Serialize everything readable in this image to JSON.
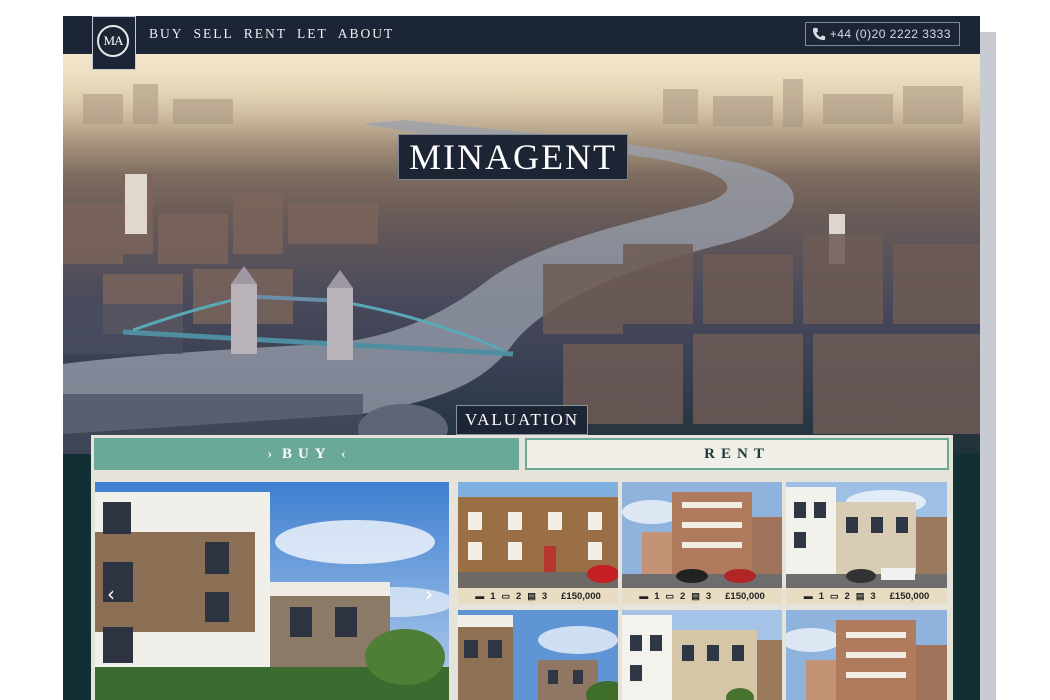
{
  "nav": {
    "logo_text": "MA",
    "menu": [
      "BUY",
      "SELL",
      "RENT",
      "LET",
      "ABOUT"
    ],
    "phone": "+44 (0)20 2222 3333",
    "phone_icon": "phone-icon"
  },
  "hero": {
    "title": "MINAGENT",
    "valuation_label": "VALUATION"
  },
  "tabs": {
    "buy": "BUY",
    "rent": "RENT",
    "buy_chevron_left": "›",
    "buy_chevron_right": "‹"
  },
  "featured": {
    "prev_arrow": "‹",
    "next_arrow": "›"
  },
  "listings": [
    {
      "beds": "1",
      "baths": "2",
      "rooms": "3",
      "price": "£150,000"
    },
    {
      "beds": "1",
      "baths": "2",
      "rooms": "3",
      "price": "£150,000"
    },
    {
      "beds": "1",
      "baths": "2",
      "rooms": "3",
      "price": "£150,000"
    }
  ],
  "colors": {
    "nav_bg": "#1c2536",
    "accent_teal": "#6aa898",
    "panel_bg": "#e6e3da",
    "meta_bar": "#e8dcc2"
  }
}
